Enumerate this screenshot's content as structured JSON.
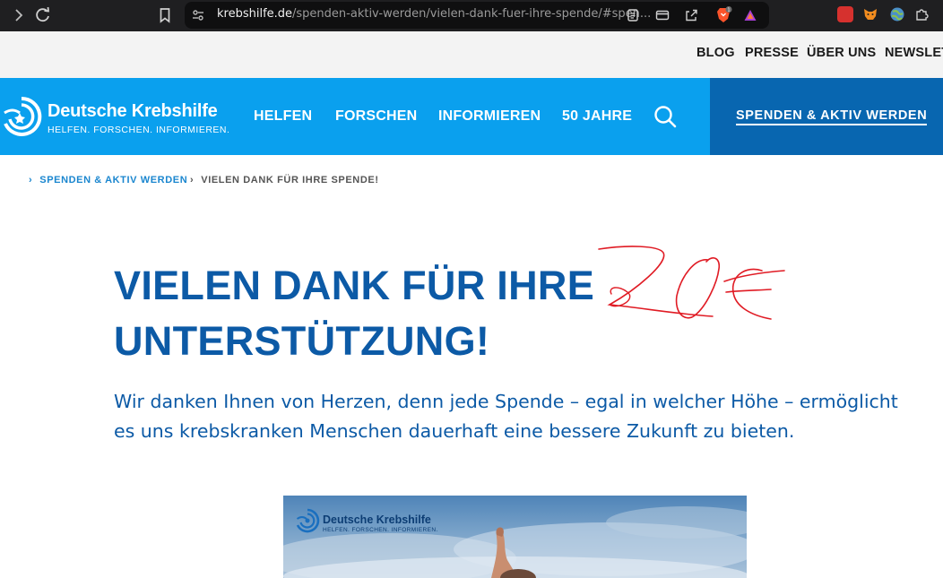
{
  "browser": {
    "url_host": "krebshilfe.de",
    "url_path": "/spenden-aktiv-werden/vielen-dank-fuer-ihre-spende/#spen..."
  },
  "utility_nav": {
    "items": [
      "BLOG",
      "PRESSE",
      "ÜBER UNS",
      "NEWSLETT"
    ]
  },
  "logo": {
    "name": "Deutsche Krebshilfe",
    "tagline": "HELFEN. FORSCHEN. INFORMIEREN."
  },
  "main_nav": {
    "items": [
      "HELFEN",
      "FORSCHEN",
      "INFORMIEREN",
      "50 JAHRE"
    ],
    "cta": "SPENDEN & AKTIV WERDEN"
  },
  "breadcrumb": {
    "items": [
      "SPENDEN & AKTIV WERDEN",
      "VIELEN DANK FÜR IHRE SPENDE!"
    ]
  },
  "content": {
    "headline_line1": "VIELEN DANK FÜR IHRE",
    "headline_line2": "UNTERSTÜTZUNG!",
    "subtext_line1": "Wir danken Ihnen von Herzen, denn jede Spende – egal in welcher Höhe – ermöglicht",
    "subtext_line2": "es uns krebskranken Menschen dauerhaft eine bessere Zukunft zu bieten."
  },
  "annotation": {
    "handwritten": "20€",
    "color": "#e01b24"
  },
  "hero_image": {
    "logo_name": "Deutsche Krebshilfe",
    "logo_tagline": "HELFEN. FORSCHEN. INFORMIEREN."
  },
  "colors": {
    "brand_blue": "#0aa0ee",
    "brand_dark": "#0866b0",
    "headline": "#0c5aa6",
    "breadcrumb_link": "#1a86cf"
  }
}
